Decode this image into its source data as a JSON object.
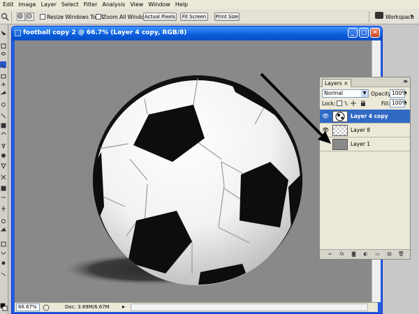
{
  "menu": [
    "Edit",
    "Image",
    "Layer",
    "Select",
    "Filter",
    "Analysis",
    "View",
    "Window",
    "Help"
  ],
  "options": {
    "resize_label": "Resize Windows To Fit",
    "zoom_all_label": "Zoom All Windows",
    "actual_pixels": "Actual Pixels",
    "fit_screen": "Fit Screen",
    "print_size": "Print Size",
    "workspace": "Workspace"
  },
  "document": {
    "title": "football copy 2 @ 66.7% (Layer 4 copy, RGB/8)",
    "zoom": "66.67%",
    "doc_info": "Doc: 3.89M/6.67M"
  },
  "layers_panel": {
    "tab": "Layers",
    "blend_mode": "Normal",
    "opacity_label": "Opacity:",
    "opacity_value": "100%",
    "lock_label": "Lock:",
    "fill_label": "Fill:",
    "fill_value": "100%",
    "layers": [
      {
        "name": "Layer 4 copy",
        "active": true,
        "visible": true
      },
      {
        "name": "Layer 8",
        "active": false,
        "visible": true
      },
      {
        "name": "Layer 1",
        "active": false,
        "visible": false
      }
    ]
  },
  "colors": {
    "titlebar": "#0a5cdb",
    "selected_layer": "#316ac5",
    "canvas": "#898989"
  }
}
